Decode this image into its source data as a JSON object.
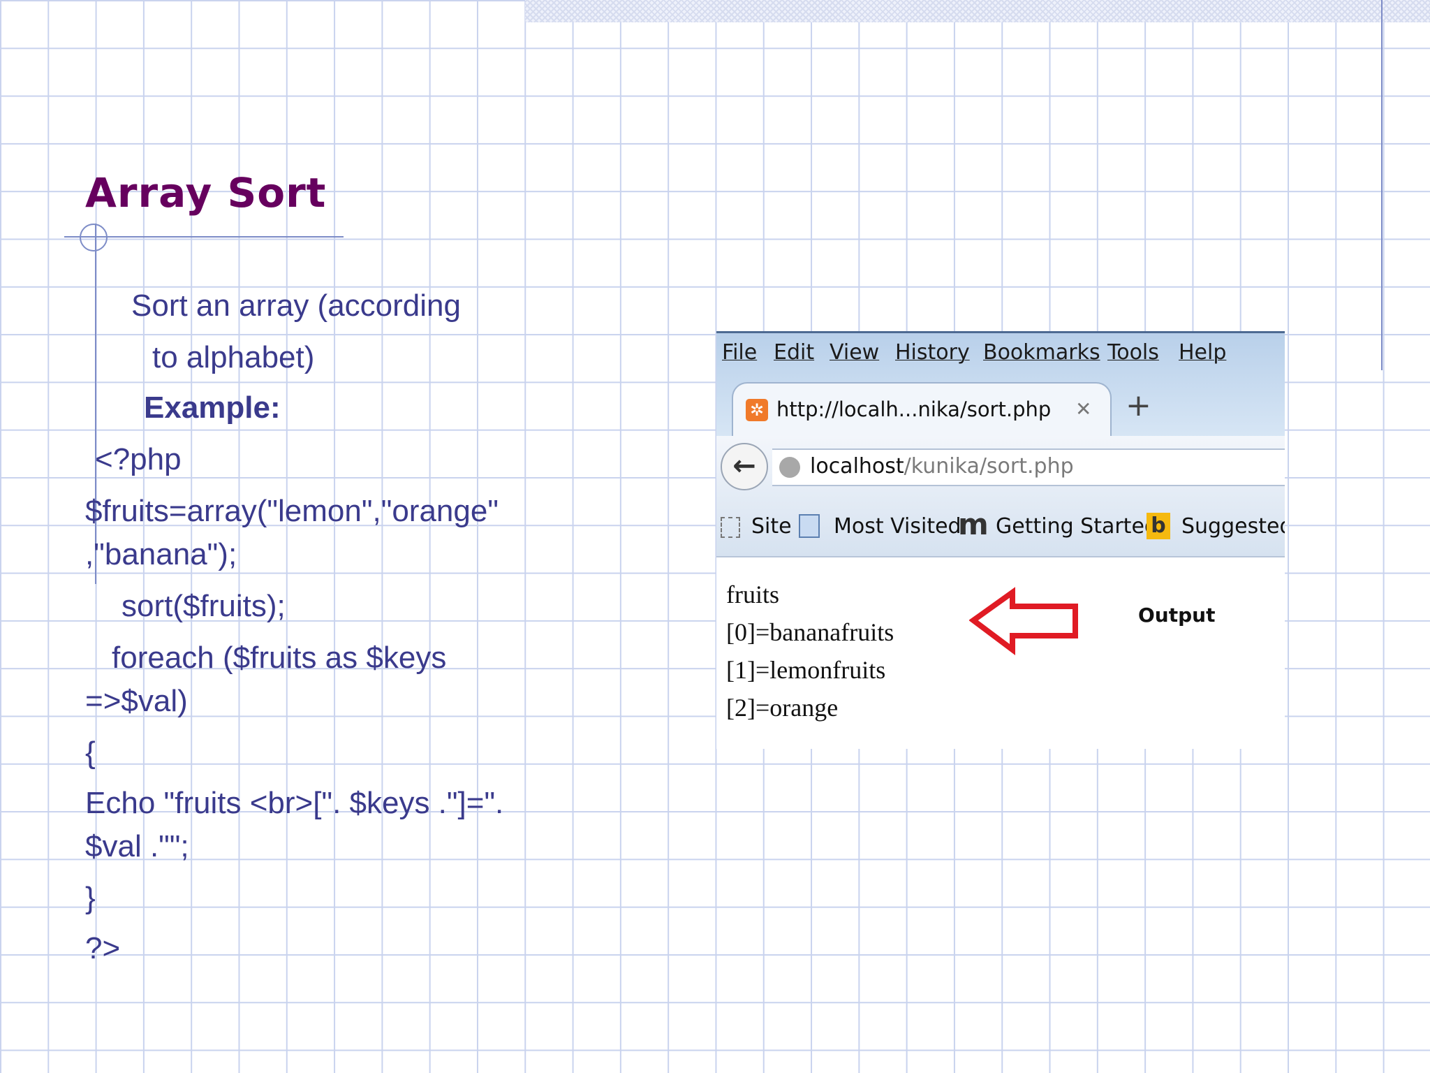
{
  "slide": {
    "title": "Array Sort",
    "description_line1": "Sort an array (according",
    "description_line2": "to alphabet)",
    "example_label": "Example:",
    "code": [
      "<?php",
      "$fruits=array(\"lemon\",\"orange\"",
      ",\"banana\");",
      "sort($fruits);",
      "foreach ($fruits as $keys",
      "=>$val)",
      "{",
      "Echo \"fruits <br>[\". $keys .\"]=\".",
      "$val .\"\";",
      "}",
      "?>"
    ]
  },
  "browser": {
    "menu": [
      "File",
      "Edit",
      "View",
      "History",
      "Bookmarks",
      "Tools",
      "Help"
    ],
    "tab_title": "http://localh...nika/sort.php",
    "tab_close": "✕",
    "new_tab": "+",
    "url_host": "localhost",
    "url_path": "/kunika/sort.php",
    "bookmarks": [
      "Site",
      "Most Visited",
      "Getting Started",
      "Suggested"
    ],
    "output_lines": [
      "fruits",
      "[0]=bananafruits",
      "[1]=lemonfruits",
      "[2]=orange"
    ],
    "output_label": "Output"
  },
  "colors": {
    "title": "#66005e",
    "text": "#3a3a8c",
    "arrow": "#e01b24"
  }
}
